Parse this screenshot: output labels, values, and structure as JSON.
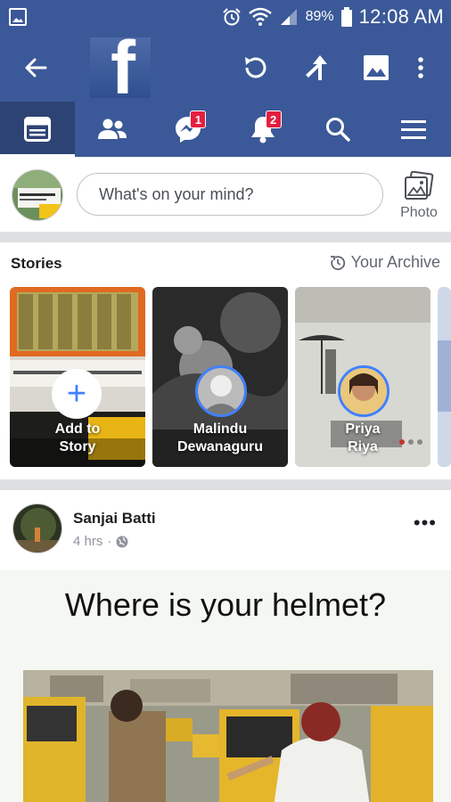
{
  "status_bar": {
    "battery_percent": "89%",
    "time": "12:08 AM",
    "icons": [
      "image-notification-icon",
      "alarm-icon",
      "wifi-icon",
      "signal-icon",
      "battery-icon"
    ]
  },
  "header": {
    "logo_letter": "f",
    "icons": [
      "back-arrow-icon",
      "refresh-icon",
      "share-icon",
      "photo-icon",
      "overflow-menu-icon"
    ]
  },
  "tabs": [
    {
      "id": "news-feed",
      "icon": "news-feed-icon",
      "active": true,
      "badge": ""
    },
    {
      "id": "friends",
      "icon": "friends-icon",
      "active": false,
      "badge": ""
    },
    {
      "id": "messenger",
      "icon": "messenger-icon",
      "active": false,
      "badge": "1"
    },
    {
      "id": "notifications",
      "icon": "bell-icon",
      "active": false,
      "badge": "2"
    },
    {
      "id": "search",
      "icon": "search-icon",
      "active": false,
      "badge": ""
    },
    {
      "id": "menu",
      "icon": "hamburger-menu-icon",
      "active": false,
      "badge": ""
    }
  ],
  "composer": {
    "placeholder": "What's on your mind?",
    "photo_label": "Photo"
  },
  "stories": {
    "title": "Stories",
    "archive_label": "Your Archive",
    "cards": [
      {
        "line1": "Add to",
        "line2": "Story"
      },
      {
        "line1": "Malindu",
        "line2": "Dewanaguru"
      },
      {
        "line1": "Priya",
        "line2": "Riya"
      }
    ]
  },
  "post": {
    "author": "Sanjai Batti",
    "time": "4 hrs",
    "more_label": "•••",
    "image_title": "Where is your helmet?"
  },
  "colors": {
    "brand_blue": "#3b5998",
    "active_tab": "#2d4373",
    "badge_red": "#e41e3f",
    "story_ring": "#4080ff"
  }
}
